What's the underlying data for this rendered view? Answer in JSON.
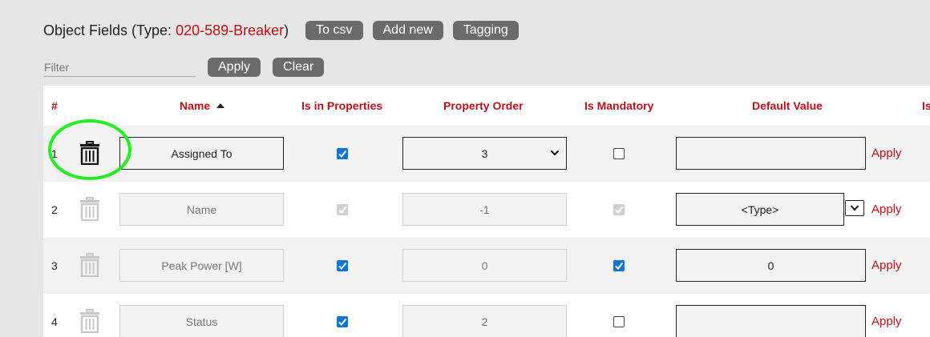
{
  "header": {
    "title_prefix": "Object Fields (Type: ",
    "type_value": "020-589-Breaker",
    "title_suffix": ")",
    "buttons": {
      "to_csv": "To csv",
      "add_new": "Add new",
      "tagging": "Tagging"
    }
  },
  "filter": {
    "placeholder": "Filter",
    "value": "",
    "apply_label": "Apply",
    "clear_label": "Clear"
  },
  "table": {
    "columns": {
      "num": "#",
      "name": "Name",
      "is_in_properties": "Is in Properties",
      "property_order": "Property Order",
      "is_mandatory": "Is Mandatory",
      "default_value": "Default Value",
      "overflow": "Is"
    },
    "sort": {
      "column": "name",
      "direction": "ascending"
    },
    "rows": [
      {
        "num": "1",
        "name": "Assigned To",
        "is_in_properties": true,
        "property_order": "3",
        "is_mandatory": false,
        "default_value": "",
        "apply": "Apply",
        "editable": true
      },
      {
        "num": "2",
        "name": "Name",
        "is_in_properties": true,
        "property_order": "-1",
        "is_mandatory": true,
        "default_value": "<Type>",
        "apply": "Apply",
        "editable": false
      },
      {
        "num": "3",
        "name": "Peak Power [W]",
        "is_in_properties": true,
        "property_order": "0",
        "is_mandatory": true,
        "default_value": "0",
        "apply": "Apply",
        "editable": false
      },
      {
        "num": "4",
        "name": "Status",
        "is_in_properties": true,
        "property_order": "2",
        "is_mandatory": false,
        "default_value": "",
        "apply": "Apply",
        "editable": false
      }
    ]
  },
  "colors": {
    "accent": "#b5121b",
    "button_bg": "#6b6b6b",
    "checkbox": "#0b74d9",
    "highlight": "#22ee22"
  },
  "icons": {
    "delete": "trash-icon",
    "dropdown": "chevron-down-icon",
    "sort": "sort-ascending-icon"
  }
}
